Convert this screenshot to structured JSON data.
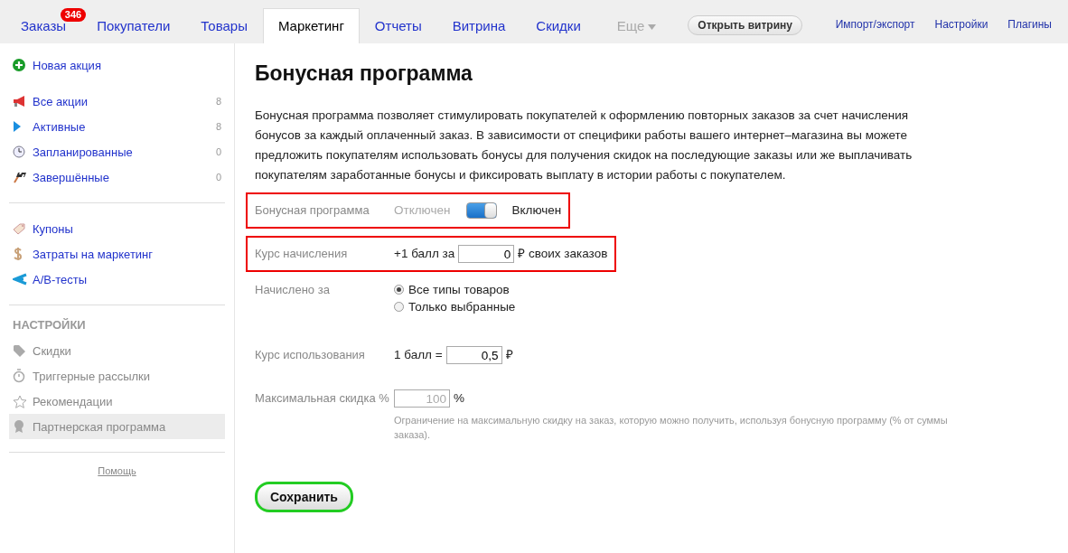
{
  "top_nav": {
    "tabs": [
      {
        "label": "Заказы",
        "badge": "346",
        "kind": "link",
        "selected": false
      },
      {
        "label": "Покупатели",
        "kind": "link",
        "selected": false
      },
      {
        "label": "Товары",
        "kind": "link",
        "selected": false
      },
      {
        "label": "Маркетинг",
        "kind": "link",
        "selected": true
      },
      {
        "label": "Отчеты",
        "kind": "link",
        "selected": false
      },
      {
        "label": "Витрина",
        "kind": "link",
        "selected": false
      },
      {
        "label": "Скидки",
        "kind": "link",
        "selected": false
      },
      {
        "label": "Еще",
        "kind": "dropdown",
        "selected": false
      }
    ],
    "open_store_button": "Открыть витрину",
    "right_links": [
      "Импорт/экспорт",
      "Настройки",
      "Плагины"
    ]
  },
  "sidebar": {
    "new_action": "Новая акция",
    "actions": [
      {
        "label": "Все акции",
        "count": "8"
      },
      {
        "label": "Активные",
        "count": "8"
      },
      {
        "label": "Запланированные",
        "count": "0"
      },
      {
        "label": "Завершённые",
        "count": "0"
      }
    ],
    "tools": [
      {
        "label": "Купоны"
      },
      {
        "label": "Затраты на маркетинг"
      },
      {
        "label": "A/B-тесты"
      }
    ],
    "settings_heading": "НАСТРОЙКИ",
    "settings": [
      {
        "label": "Скидки",
        "selected": false
      },
      {
        "label": "Триггерные рассылки",
        "selected": false
      },
      {
        "label": "Рекомендации",
        "selected": false
      },
      {
        "label": "Партнерская программа",
        "selected": true
      }
    ],
    "help_link": "Помощь"
  },
  "main": {
    "title": "Бонусная программа",
    "description": "Бонусная программа позволяет стимулировать покупателей к оформлению повторных заказов за счет начисления бонусов за каждый оплаченный заказ. В зависимости от специфики работы вашего интернет–магазина вы можете предложить покупателям использовать бонусы для получения скидок на последующие заказы или же выплачивать покупателям заработанные бонусы и фиксировать выплату в истории работы с покупателем.",
    "fields": [
      {
        "kind": "toggle",
        "label": "Бонусная программа",
        "highlighted": true,
        "off_label": "Отключен",
        "on_label": "Включен",
        "on": true
      },
      {
        "kind": "input",
        "label": "Курс начисления",
        "highlighted": true,
        "prefix": "+1 балл за",
        "value": "0",
        "suffix": "₽ своих заказов"
      },
      {
        "kind": "radio",
        "label": "Начислено за",
        "highlighted": false,
        "options": [
          {
            "label": "Все типы товаров",
            "selected": true
          },
          {
            "label": "Только выбранные",
            "selected": false
          }
        ]
      },
      {
        "kind": "input",
        "label": "Курс использования",
        "highlighted": false,
        "prefix": "1 балл =",
        "value": "0,5",
        "suffix": "₽"
      },
      {
        "kind": "input",
        "label": "Максимальная скидка %",
        "highlighted": false,
        "placeholder": "100",
        "suffix": "%",
        "hint": "Ограничение на максимальную скидку на заказ, которую можно получить, используя бонусную программу (% от суммы заказа)."
      }
    ],
    "save_button": "Сохранить"
  }
}
